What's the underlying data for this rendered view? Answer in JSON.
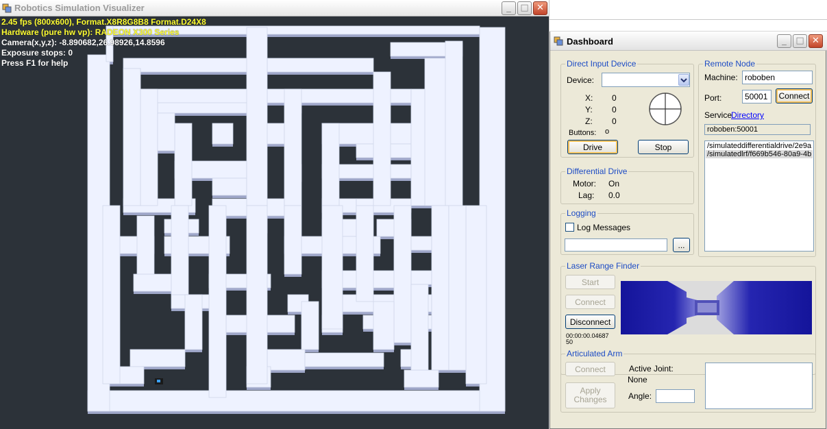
{
  "visualizer": {
    "title": "Robotics Simulation Visualizer",
    "hud": {
      "line1": "2.45 fps (800x600), Format.X8R8G8B8 Format.D24X8",
      "line2": "Hardware (pure hw vp): RADEON X300 Series",
      "line3": "Camera(x,y,z): -8.890682,26.98926,14.8596",
      "line4": "Exposure stops: 0",
      "line5": "Press F1 for help"
    },
    "buttons": {
      "minimize": "_",
      "maximize": "□",
      "close": "✕"
    }
  },
  "dashboard": {
    "title": "Dashboard",
    "direct_input": {
      "title": "Direct Input Device",
      "device_label": "Device:",
      "device_value": "",
      "x_label": "X:",
      "x_value": "0",
      "y_label": "Y:",
      "y_value": "0",
      "z_label": "Z:",
      "z_value": "0",
      "buttons_label": "Buttons:",
      "buttons_value": "o",
      "drive_label": "Drive",
      "stop_label": "Stop"
    },
    "remote_node": {
      "title": "Remote Node",
      "machine_label": "Machine:",
      "machine_value": "roboben",
      "port_label": "Port:",
      "port_value": "50001",
      "connect_label": "Connect",
      "service_label": "Service",
      "directory_link": "Directory",
      "service_value": "roboben:50001",
      "services": [
        "/simulateddifferentialdrive/2e9a",
        "/simulatedlrf/f669b546-80a9-4b"
      ]
    },
    "differential_drive": {
      "title": "Differential Drive",
      "motor_label": "Motor:",
      "motor_value": "On",
      "lag_label": "Lag:",
      "lag_value": "0.0"
    },
    "logging": {
      "title": "Logging",
      "log_messages_label": "Log Messages",
      "log_checked": false,
      "file_value": "",
      "browse_label": "..."
    },
    "laser": {
      "title": "Laser Range Finder",
      "start_label": "Start",
      "connect_label": "Connect",
      "disconnect_label": "Disconnect",
      "time_value": "00:00:00.04687",
      "time_value2": "50"
    },
    "arm": {
      "title": "Articulated Arm",
      "connect_label": "Connect",
      "apply_label1": "Apply",
      "apply_label2": "Changes",
      "active_joint_label": "Active Joint:",
      "active_joint_value": "None",
      "angle_label": "Angle:",
      "angle_value": ""
    }
  },
  "colors": {
    "group_title": "#1c4bc4",
    "hud_yellow": "#ffff33",
    "laser_dark": "#16169a",
    "laser_light": "#b4b4e6"
  }
}
